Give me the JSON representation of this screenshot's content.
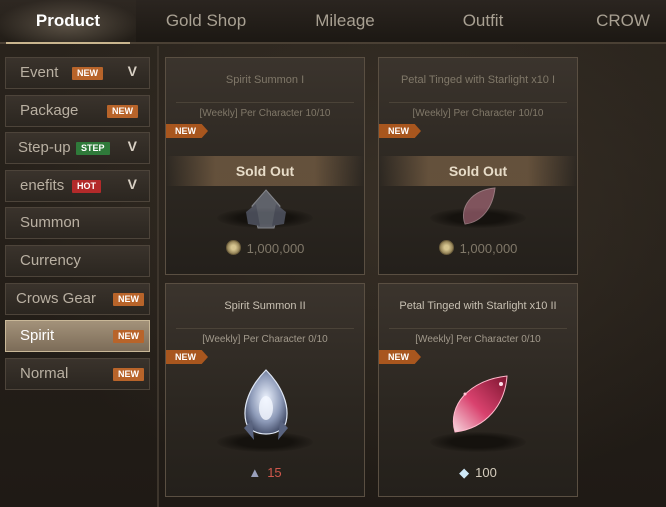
{
  "tabs": [
    {
      "label": "Product",
      "active": true
    },
    {
      "label": "Gold Shop",
      "active": false
    },
    {
      "label": "Mileage",
      "active": false
    },
    {
      "label": "Outfit",
      "active": false
    },
    {
      "label": "CROW",
      "active": false
    }
  ],
  "menu": [
    {
      "label": "Event",
      "badge": "NEW",
      "badge_type": "new",
      "expandable": true
    },
    {
      "label": "Package",
      "badge": "NEW",
      "badge_type": "new",
      "expandable": false
    },
    {
      "label": "Step-up",
      "badge": "STEP",
      "badge_type": "step",
      "expandable": true
    },
    {
      "label": "enefits",
      "badge": "HOT",
      "badge_type": "hot",
      "expandable": true
    },
    {
      "label": "Summon",
      "badge": "",
      "expandable": false
    },
    {
      "label": "Currency",
      "badge": "",
      "expandable": false
    },
    {
      "label": "Crows Gear",
      "badge": "NEW",
      "badge_type": "new",
      "expandable": false
    },
    {
      "label": "Spirit",
      "badge": "NEW",
      "badge_type": "new",
      "expandable": false,
      "active": true
    },
    {
      "label": "Normal",
      "badge": "NEW",
      "badge_type": "new",
      "expandable": false
    }
  ],
  "cards": [
    {
      "title": "Spirit Summon I",
      "limit": "[Weekly] Per Character 10/10",
      "tag": "NEW",
      "status": "Sold Out",
      "price": "1,000,000",
      "currency_icon": "gold-coin-icon"
    },
    {
      "title": "Petal Tinged with Starlight x10 I",
      "limit": "[Weekly] Per Character 10/10",
      "tag": "NEW",
      "status": "Sold Out",
      "price": "1,000,000",
      "currency_icon": "gold-coin-icon"
    },
    {
      "title": "Spirit Summon II",
      "limit": "[Weekly] Per Character 0/10",
      "tag": "NEW",
      "status": "",
      "price": "15",
      "currency_icon": "crest-icon"
    },
    {
      "title": "Petal Tinged with Starlight x10 II",
      "limit": "[Weekly] Per Character 0/10",
      "tag": "NEW",
      "status": "",
      "price": "100",
      "currency_icon": "diamond-icon"
    }
  ],
  "colors": {
    "new": "#b8642a",
    "step": "#2f7a3a",
    "hot": "#b32a2a",
    "accent": "#c9b58e",
    "price_red": "#d0574c"
  }
}
